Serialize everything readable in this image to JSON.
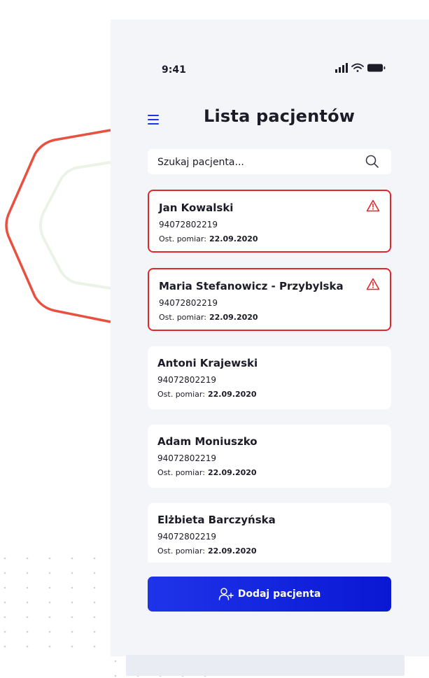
{
  "colors": {
    "accent": "#0a17d4",
    "alert": "#e3262c",
    "decor_line": "#e8513f",
    "background": "#f3f5f9"
  },
  "status_bar": {
    "time": "9:41",
    "icons": [
      "signal-icon",
      "wifi-icon",
      "battery-icon"
    ]
  },
  "header": {
    "menu_icon": "hamburger-menu-icon",
    "title": "Lista pacjentów"
  },
  "search": {
    "placeholder": "Szukaj pacjenta...",
    "value": "",
    "icon": "search-icon"
  },
  "patients": [
    {
      "name": "Jan Kowalski",
      "id": "94072802219",
      "measure_label": "Ost. pomiar:",
      "measure_date": "22.09.2020",
      "alert": true
    },
    {
      "name": "Maria Stefanowicz - Przybylska",
      "id": "94072802219",
      "measure_label": "Ost. pomiar:",
      "measure_date": "22.09.2020",
      "alert": true
    },
    {
      "name": "Antoni Krajewski",
      "id": "94072802219",
      "measure_label": "Ost. pomiar:",
      "measure_date": "22.09.2020",
      "alert": false
    },
    {
      "name": "Adam Moniuszko",
      "id": "94072802219",
      "measure_label": "Ost. pomiar:",
      "measure_date": "22.09.2020",
      "alert": false
    },
    {
      "name": "Elżbieta Barczyńska",
      "id": "94072802219",
      "measure_label": "Ost. pomiar:",
      "measure_date": "22.09.2020",
      "alert": false
    }
  ],
  "actions": {
    "add_patient_label": "Dodaj pacjenta",
    "add_patient_icon": "add-user-icon"
  }
}
